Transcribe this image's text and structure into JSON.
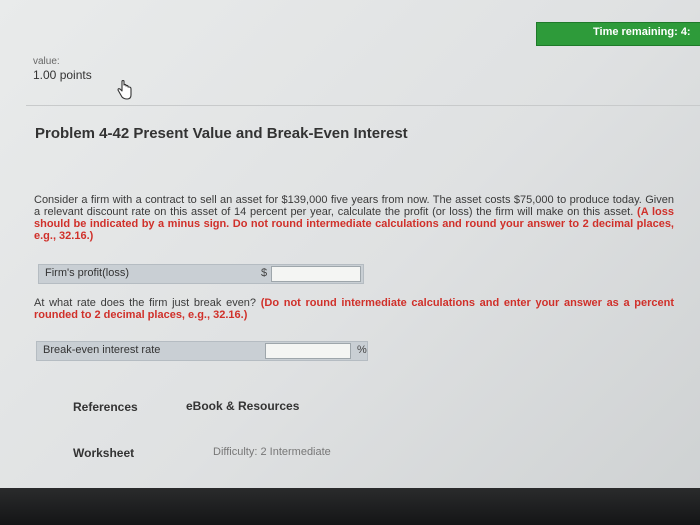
{
  "timer": {
    "label": "Time remaining: 4:"
  },
  "score": {
    "value_label": "value:",
    "points": "1.00 points"
  },
  "problem": {
    "title": "Problem 4-42 Present Value and Break-Even Interest"
  },
  "q1": {
    "text": "Consider a firm with a contract to sell an asset for $139,000 five years from now. The asset costs $75,000 to produce today. Given a relevant discount rate on this asset of 14 percent per year, calculate the profit (or loss) the firm will make on this asset.",
    "instruction": "(A loss should be indicated by a minus sign. Do not round intermediate calculations and round your answer to 2 decimal places, e.g., 32.16.)",
    "label": "Firm's profit(loss)",
    "currency": "$"
  },
  "q2": {
    "text": "At what rate does the firm just break even?",
    "instruction": "(Do not round intermediate calculations and enter your answer as a percent rounded to 2 decimal places, e.g., 32.16.)",
    "label": "Break-even interest rate",
    "unit": "%"
  },
  "links": {
    "references": "References",
    "ebook": "eBook & Resources",
    "worksheet": "Worksheet"
  },
  "difficulty": "Difficulty: 2 Intermediate",
  "colors": {
    "timer_bg": "#2e9b3a",
    "instruction_red": "#d0302a",
    "row_bg": "#c9cfd4"
  }
}
